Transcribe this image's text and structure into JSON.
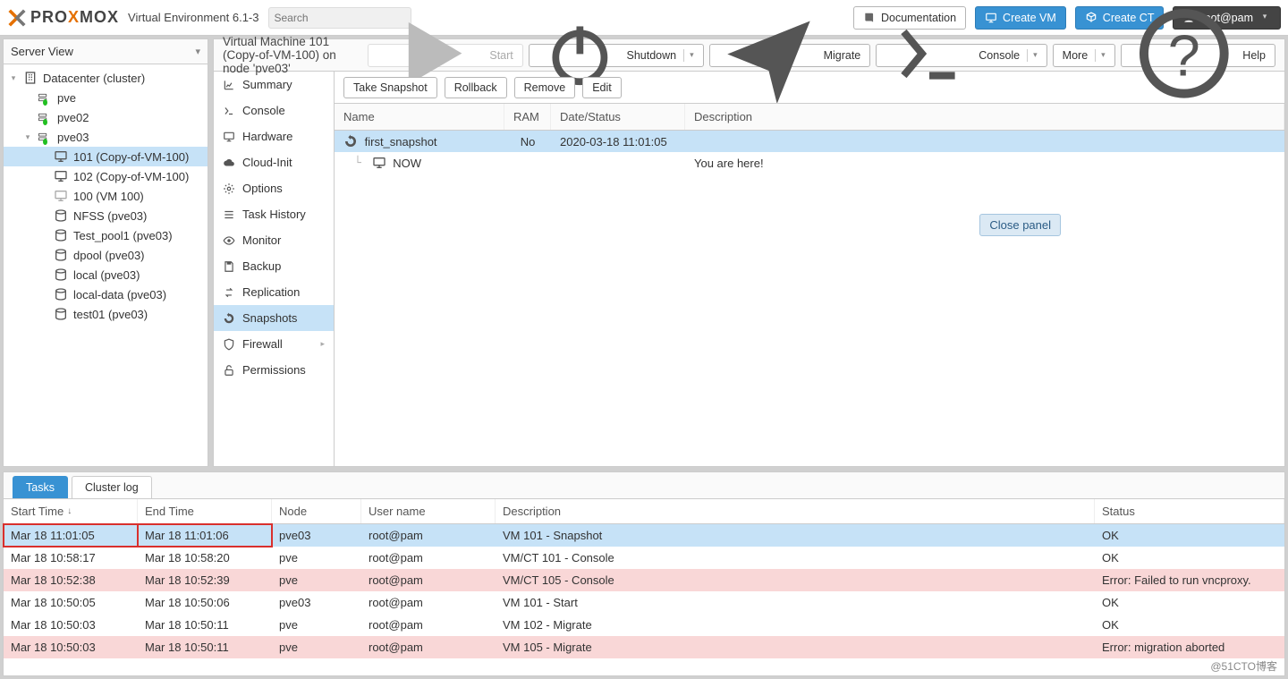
{
  "header": {
    "env_label": "Virtual Environment 6.1-3",
    "search_placeholder": "Search",
    "doc_label": "Documentation",
    "create_vm_label": "Create VM",
    "create_ct_label": "Create CT",
    "user_label": "root@pam"
  },
  "tree": {
    "view_label": "Server View",
    "root": "Datacenter (cluster)",
    "nodes": [
      {
        "label": "pve"
      },
      {
        "label": "pve02"
      },
      {
        "label": "pve03",
        "expanded": true,
        "children": [
          {
            "label": "101 (Copy-of-VM-100)",
            "icon": "monitor-icon",
            "selected": true
          },
          {
            "label": "102 (Copy-of-VM-100)",
            "icon": "monitor-icon"
          },
          {
            "label": "100 (VM 100)",
            "icon": "monitor-off-icon"
          },
          {
            "label": "NFSS (pve03)",
            "icon": "storage-icon"
          },
          {
            "label": "Test_pool1 (pve03)",
            "icon": "storage-icon"
          },
          {
            "label": "dpool (pve03)",
            "icon": "storage-icon"
          },
          {
            "label": "local (pve03)",
            "icon": "storage-icon"
          },
          {
            "label": "local-data (pve03)",
            "icon": "storage-icon"
          },
          {
            "label": "test01 (pve03)",
            "icon": "storage-icon"
          }
        ]
      }
    ]
  },
  "vm_panel": {
    "title": "Virtual Machine 101 (Copy-of-VM-100) on node 'pve03'",
    "actions": {
      "start": "Start",
      "shutdown": "Shutdown",
      "migrate": "Migrate",
      "console": "Console",
      "more": "More",
      "help": "Help"
    },
    "sidenav": [
      {
        "icon": "chart-icon",
        "label": "Summary"
      },
      {
        "icon": "terminal-icon",
        "label": "Console"
      },
      {
        "icon": "monitor-icon",
        "label": "Hardware"
      },
      {
        "icon": "cloud-icon",
        "label": "Cloud-Init"
      },
      {
        "icon": "gear-icon",
        "label": "Options"
      },
      {
        "icon": "list-icon",
        "label": "Task History"
      },
      {
        "icon": "eye-icon",
        "label": "Monitor"
      },
      {
        "icon": "save-icon",
        "label": "Backup"
      },
      {
        "icon": "retweet-icon",
        "label": "Replication"
      },
      {
        "icon": "history-icon",
        "label": "Snapshots",
        "selected": true
      },
      {
        "icon": "shield-icon",
        "label": "Firewall",
        "sub": true
      },
      {
        "icon": "unlock-icon",
        "label": "Permissions"
      }
    ],
    "snap_toolbar": {
      "take": "Take Snapshot",
      "rollback": "Rollback",
      "remove": "Remove",
      "edit": "Edit"
    },
    "snap_columns": {
      "name": "Name",
      "ram": "RAM",
      "date": "Date/Status",
      "desc": "Description"
    },
    "snapshots": [
      {
        "name": "first_snapshot",
        "ram": "No",
        "date": "2020-03-18 11:01:05",
        "desc": "",
        "icon": "history-icon",
        "selected": true,
        "depth": 0
      },
      {
        "name": "NOW",
        "ram": "",
        "date": "",
        "desc": "You are here!",
        "icon": "monitor-icon",
        "depth": 1
      }
    ],
    "close_panel_label": "Close panel"
  },
  "tasks_panel": {
    "tabs": {
      "tasks": "Tasks",
      "cluster_log": "Cluster log"
    },
    "columns": {
      "start": "Start Time",
      "end": "End Time",
      "node": "Node",
      "user": "User name",
      "desc": "Description",
      "status": "Status"
    },
    "rows": [
      {
        "start": "Mar 18 11:01:05",
        "end": "Mar 18 11:01:06",
        "node": "pve03",
        "user": "root@pam",
        "desc": "VM 101 - Snapshot",
        "status": "OK",
        "sel": true,
        "hl": true
      },
      {
        "start": "Mar 18 10:58:17",
        "end": "Mar 18 10:58:20",
        "node": "pve",
        "user": "root@pam",
        "desc": "VM/CT 101 - Console",
        "status": "OK"
      },
      {
        "start": "Mar 18 10:52:38",
        "end": "Mar 18 10:52:39",
        "node": "pve",
        "user": "root@pam",
        "desc": "VM/CT 105 - Console",
        "status": "Error: Failed to run vncproxy.",
        "err": true
      },
      {
        "start": "Mar 18 10:50:05",
        "end": "Mar 18 10:50:06",
        "node": "pve03",
        "user": "root@pam",
        "desc": "VM 101 - Start",
        "status": "OK"
      },
      {
        "start": "Mar 18 10:50:03",
        "end": "Mar 18 10:50:11",
        "node": "pve",
        "user": "root@pam",
        "desc": "VM 102 - Migrate",
        "status": "OK"
      },
      {
        "start": "Mar 18 10:50:03",
        "end": "Mar 18 10:50:11",
        "node": "pve",
        "user": "root@pam",
        "desc": "VM 105 - Migrate",
        "status": "Error: migration aborted",
        "err": true
      }
    ]
  },
  "watermark": "@51CTO博客"
}
